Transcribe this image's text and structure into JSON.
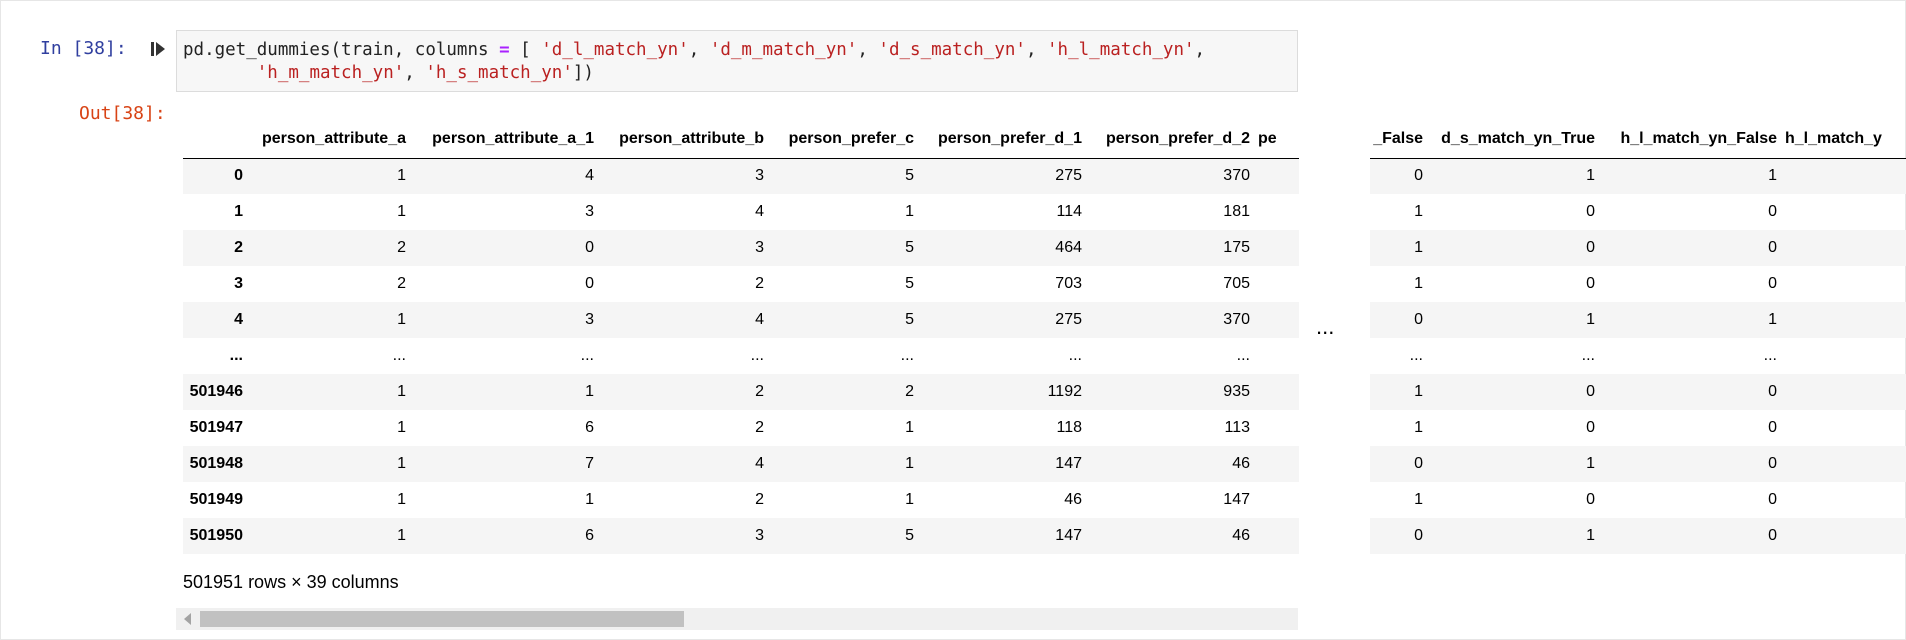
{
  "cell": {
    "in_prompt": "In [38]:",
    "out_prompt": "Out[38]:",
    "code_line1": {
      "a": "pd.get_dummies(train, columns ",
      "eq": "=",
      "b": " [ ",
      "s1": "'d_l_match_yn'",
      "c1": ", ",
      "s2": "'d_m_match_yn'",
      "c2": ", ",
      "s3": "'d_s_match_yn'",
      "c3": ", ",
      "s4": "'h_l_match_yn'",
      "c4": ","
    },
    "code_line2": {
      "indent": "       ",
      "s5": "'h_m_match_yn'",
      "c5": ", ",
      "s6": "'h_s_match_yn'",
      "end": "])"
    }
  },
  "table_left": {
    "columns": [
      "",
      "person_attribute_a",
      "person_attribute_a_1",
      "person_attribute_b",
      "person_prefer_c",
      "person_prefer_d_1",
      "person_prefer_d_2",
      "pe"
    ],
    "rows": [
      [
        "0",
        "1",
        "4",
        "3",
        "5",
        "275",
        "370",
        ""
      ],
      [
        "1",
        "1",
        "3",
        "4",
        "1",
        "114",
        "181",
        ""
      ],
      [
        "2",
        "2",
        "0",
        "3",
        "5",
        "464",
        "175",
        ""
      ],
      [
        "3",
        "2",
        "0",
        "2",
        "5",
        "703",
        "705",
        ""
      ],
      [
        "4",
        "1",
        "3",
        "4",
        "5",
        "275",
        "370",
        ""
      ],
      [
        "...",
        "...",
        "...",
        "...",
        "...",
        "...",
        "...",
        ""
      ],
      [
        "501946",
        "1",
        "1",
        "2",
        "2",
        "1192",
        "935",
        ""
      ],
      [
        "501947",
        "1",
        "6",
        "2",
        "1",
        "118",
        "113",
        ""
      ],
      [
        "501948",
        "1",
        "7",
        "4",
        "1",
        "147",
        "46",
        ""
      ],
      [
        "501949",
        "1",
        "1",
        "2",
        "1",
        "46",
        "147",
        ""
      ],
      [
        "501950",
        "1",
        "6",
        "3",
        "5",
        "147",
        "46",
        ""
      ]
    ]
  },
  "table_right": {
    "columns": [
      "_False",
      "d_s_match_yn_True",
      "h_l_match_yn_False",
      "h_l_match_y"
    ],
    "rows": [
      [
        "0",
        "1",
        "1",
        ""
      ],
      [
        "1",
        "0",
        "0",
        ""
      ],
      [
        "1",
        "0",
        "0",
        ""
      ],
      [
        "1",
        "0",
        "0",
        ""
      ],
      [
        "0",
        "1",
        "1",
        ""
      ],
      [
        "...",
        "...",
        "...",
        ""
      ],
      [
        "1",
        "0",
        "0",
        ""
      ],
      [
        "1",
        "0",
        "0",
        ""
      ],
      [
        "0",
        "1",
        "0",
        ""
      ],
      [
        "1",
        "0",
        "0",
        ""
      ],
      [
        "0",
        "1",
        "0",
        ""
      ]
    ]
  },
  "ellipsis": "...",
  "shape_text": "501951 rows × 39 columns",
  "icons": {
    "run": "run-cell-icon",
    "scroll_left": "arrow-left-icon"
  },
  "colors": {
    "in_prompt": "#303f9f",
    "out_prompt": "#d84315",
    "string": "#ba2121",
    "operator": "#aa22ff",
    "row_stripe": "#f5f5f5"
  }
}
